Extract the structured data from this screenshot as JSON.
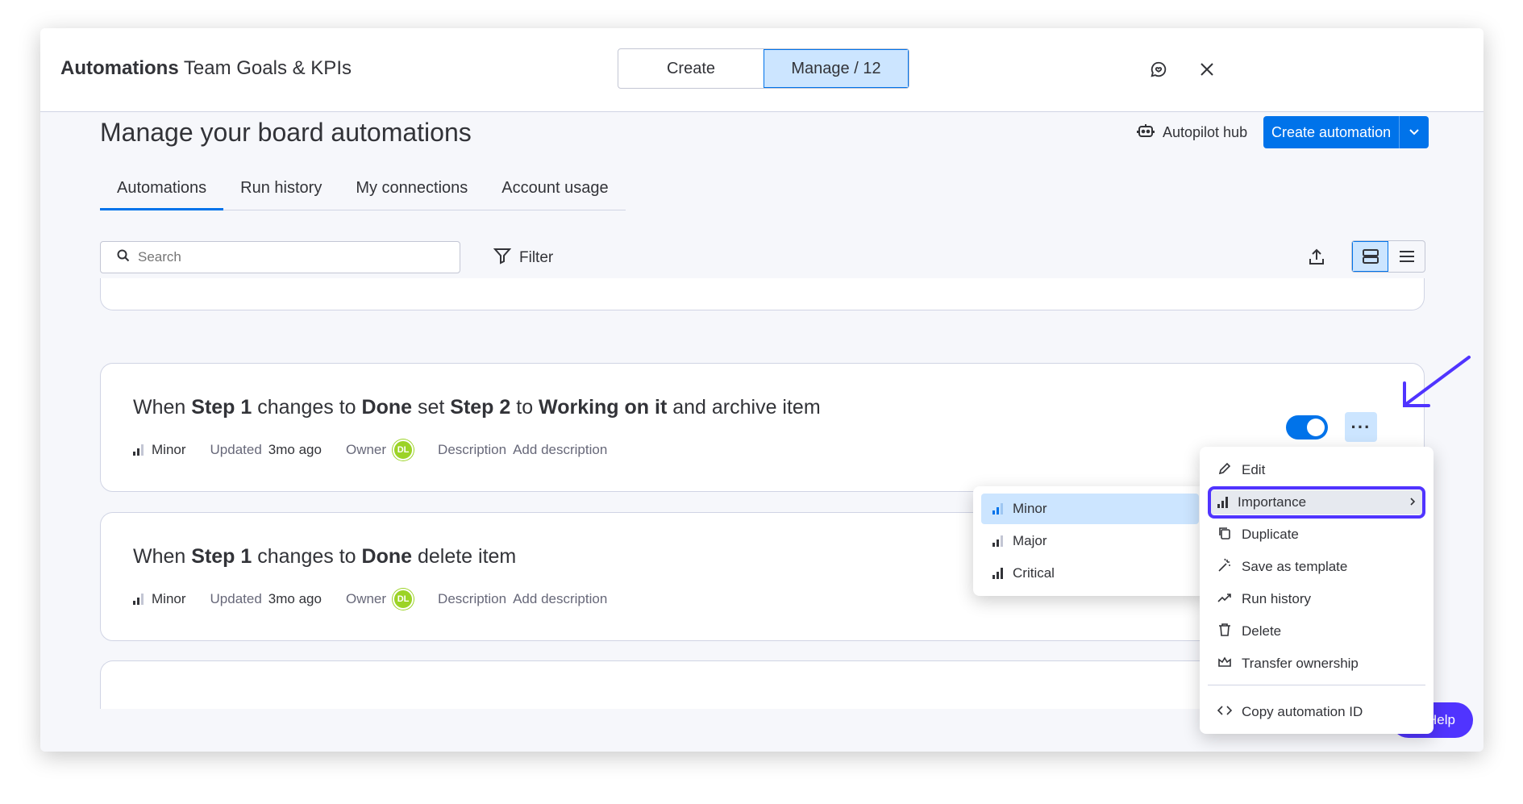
{
  "header": {
    "title_bold": "Automations",
    "title_rest": "Team Goals & KPIs",
    "seg_create": "Create",
    "seg_manage": "Manage / 12"
  },
  "page": {
    "heading": "Manage your board automations",
    "autopilot_label": "Autopilot hub",
    "create_label": "Create automation"
  },
  "tabs": [
    {
      "label": "Automations"
    },
    {
      "label": "Run history"
    },
    {
      "label": "My connections"
    },
    {
      "label": "Account usage"
    }
  ],
  "toolbar": {
    "search_placeholder": "Search",
    "filter_label": "Filter"
  },
  "cards": [
    {
      "p1": "When ",
      "b1": "Step 1",
      "p2": " changes to ",
      "b2": "Done",
      "p3": " set ",
      "b3": "Step 2",
      "p4": " to ",
      "b4": "Working on it",
      "p5": " and archive item",
      "importance": "Minor",
      "updated_label": "Updated",
      "updated_value": "3mo ago",
      "owner_label": "Owner",
      "owner_initials": "DL",
      "description_label": "Description",
      "description_value": "Add description"
    },
    {
      "p1": "When ",
      "b1": "Step 1",
      "p2": " changes to ",
      "b2": "Done",
      "p3": " delete item",
      "importance": "Minor",
      "updated_label": "Updated",
      "updated_value": "3mo ago",
      "owner_label": "Owner",
      "owner_initials": "DL",
      "description_label": "Description",
      "description_value": "Add description"
    }
  ],
  "more_label": "···",
  "menu": [
    {
      "label": "Edit",
      "icon": "pencil-icon"
    },
    {
      "label": "Importance",
      "icon": "bars-icon"
    },
    {
      "label": "Duplicate",
      "icon": "copy-icon"
    },
    {
      "label": "Save as template",
      "icon": "wand-icon"
    },
    {
      "label": "Run history",
      "icon": "trend-icon"
    },
    {
      "label": "Delete",
      "icon": "trash-icon"
    },
    {
      "label": "Transfer ownership",
      "icon": "crown-icon"
    },
    {
      "label": "Copy automation ID",
      "icon": "code-icon"
    }
  ],
  "submenu": [
    {
      "label": "Minor"
    },
    {
      "label": "Major"
    },
    {
      "label": "Critical"
    }
  ],
  "help_label": "Help",
  "colors": {
    "primary": "#0073ea",
    "selected": "#cce5ff",
    "highlight": "#5034ff",
    "avatar": "#9cd326"
  }
}
